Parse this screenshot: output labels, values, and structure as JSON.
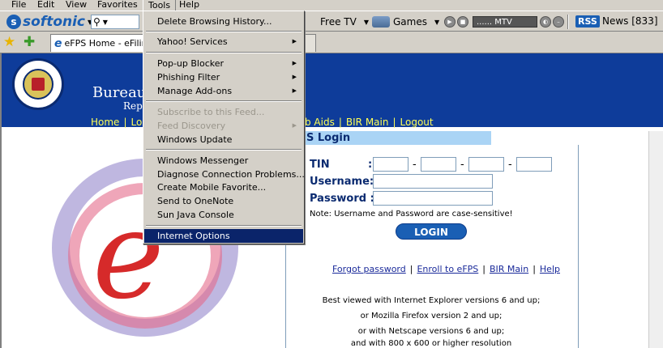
{
  "menubar": {
    "items": [
      "File",
      "Edit",
      "View",
      "Favorites",
      "Tools",
      "Help"
    ]
  },
  "toolbar": {
    "softonic_label": "softonic",
    "free_tv_label": "Free TV",
    "games_label": "Games",
    "player_station": "...... MTV",
    "rss_label": "RSS",
    "news_label": "News [833]"
  },
  "tab": {
    "title": "eFPS Home - eFiling"
  },
  "tools_menu": {
    "items": [
      {
        "label": "Delete Browsing History...",
        "submenu": false,
        "disabled": false
      },
      {
        "label": "Yahoo! Services",
        "submenu": true,
        "disabled": false
      },
      {
        "label": "Pop-up Blocker",
        "submenu": true,
        "disabled": false
      },
      {
        "label": "Phishing Filter",
        "submenu": true,
        "disabled": false
      },
      {
        "label": "Manage Add-ons",
        "submenu": true,
        "disabled": false
      },
      {
        "label": "Subscribe to this Feed...",
        "submenu": false,
        "disabled": true
      },
      {
        "label": "Feed Discovery",
        "submenu": true,
        "disabled": true
      },
      {
        "label": "Windows Update",
        "submenu": false,
        "disabled": false
      },
      {
        "label": "Windows Messenger",
        "submenu": false,
        "disabled": false
      },
      {
        "label": "Diagnose Connection Problems...",
        "submenu": false,
        "disabled": false
      },
      {
        "label": "Create Mobile Favorite...",
        "submenu": false,
        "disabled": false
      },
      {
        "label": "Send to OneNote",
        "submenu": false,
        "disabled": false
      },
      {
        "label": "Sun Java Console",
        "submenu": false,
        "disabled": false
      },
      {
        "label": "Internet Options",
        "submenu": false,
        "disabled": false,
        "highlighted": true
      }
    ]
  },
  "page": {
    "bureau_title": "Bureau",
    "bureau_sub": "Rep",
    "nav_left": [
      "Home",
      "Lo"
    ],
    "nav_right": [
      "b Aids",
      "BIR Main",
      "Logout"
    ],
    "login_heading": "S Login",
    "tin_label": "TIN",
    "tin_colon": ":",
    "tin_dash": "-",
    "username_label": "Username:",
    "password_label": "Password :",
    "note": "Note: Username and Password are case-sensitive!",
    "login_button": "LOGIN",
    "links": [
      "Forgot password",
      "Enroll to eFPS",
      "BIR Main",
      "Help"
    ],
    "info_lines": [
      "Best viewed with Internet Explorer versions 6 and up;",
      "or Mozilla Firefox version 2 and up;",
      "or with Netscape versions 6 and up;",
      "and with 800 x 600 or higher resolution"
    ]
  },
  "colors": {
    "header_blue": "#0e3c9a",
    "nav_link_yellow": "#ffff55",
    "menu_highlight": "#0a246a"
  }
}
